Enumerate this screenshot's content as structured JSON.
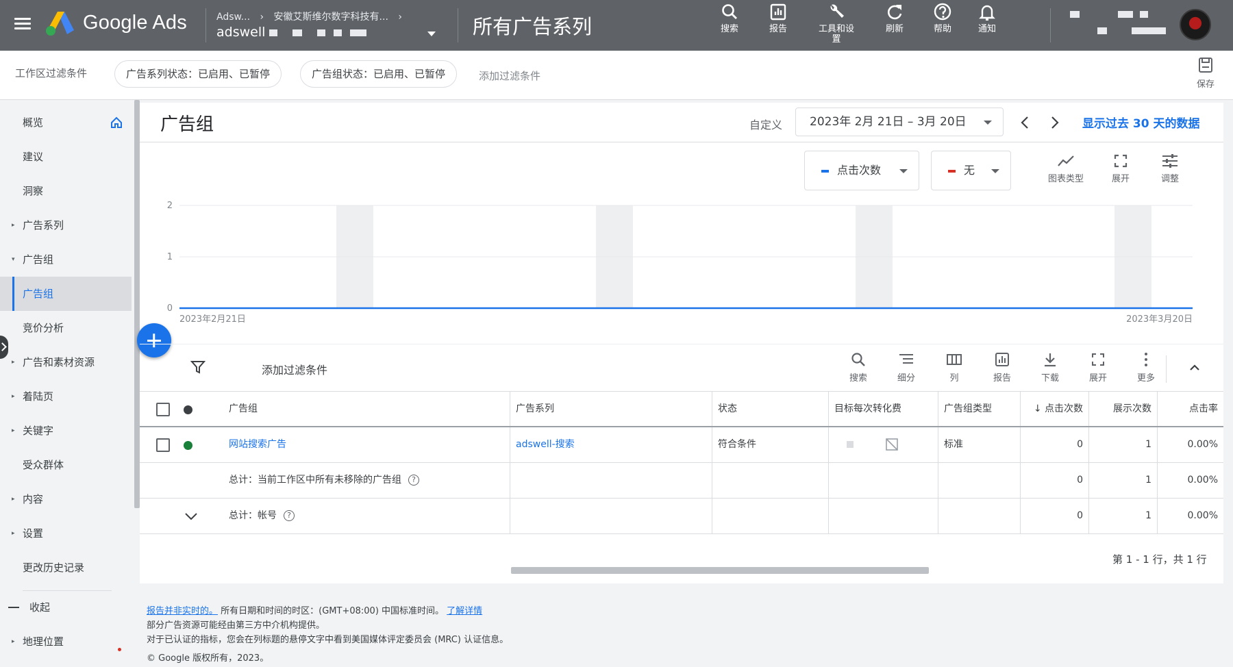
{
  "topbar": {
    "brand": "Google Ads",
    "breadcrumb_account": "Adsw...",
    "breadcrumb_company": "安徽艾斯维尔数字科技有...",
    "account_name": "adswell",
    "page_title": "所有广告系列",
    "tools": [
      {
        "label": "搜索",
        "icon": "search-icon"
      },
      {
        "label": "报告",
        "icon": "report-icon"
      },
      {
        "label": "工具和设置",
        "icon": "wrench-icon"
      },
      {
        "label": "刷新",
        "icon": "refresh-icon"
      },
      {
        "label": "帮助",
        "icon": "help-icon"
      },
      {
        "label": "通知",
        "icon": "bell-icon"
      }
    ]
  },
  "filterbar": {
    "label": "工作区过滤条件",
    "chip_campaign": "广告系列状态：已启用、已暂停",
    "chip_adgroup": "广告组状态：已启用、已暂停",
    "add_filter": "添加过滤条件",
    "save": "保存"
  },
  "sidebar": {
    "items": [
      {
        "label": "概览",
        "arrow": ""
      },
      {
        "label": "建议",
        "arrow": ""
      },
      {
        "label": "洞察",
        "arrow": ""
      },
      {
        "label": "广告系列",
        "arrow": "▸"
      },
      {
        "label": "广告组",
        "arrow": "▾"
      },
      {
        "label": "广告组",
        "arrow": ""
      },
      {
        "label": "竞价分析",
        "arrow": ""
      },
      {
        "label": "广告和素材资源",
        "arrow": "▸"
      },
      {
        "label": "着陆页",
        "arrow": "▸"
      },
      {
        "label": "关键字",
        "arrow": "▸"
      },
      {
        "label": "受众群体",
        "arrow": ""
      },
      {
        "label": "内容",
        "arrow": "▸"
      },
      {
        "label": "设置",
        "arrow": "▸"
      },
      {
        "label": "更改历史记录",
        "arrow": ""
      }
    ],
    "collapse_label": "收起",
    "geo_label": "地理位置"
  },
  "main": {
    "title": "广告组",
    "custom_label": "自定义",
    "date_range": "2023年 2月 21日 – 3月 20日",
    "show_30_days": "显示过去 30 天的数据",
    "metric1": "点击次数",
    "metric2": "无",
    "chart_tools": [
      "图表类型",
      "展开",
      "调整"
    ]
  },
  "chart_data": {
    "type": "line",
    "series": [
      {
        "name": "点击次数",
        "values": [
          0,
          0
        ]
      }
    ],
    "x": [
      "2023年2月21日",
      "2023年3月20日"
    ],
    "x_start_label": "2023年2月21日",
    "x_end_label": "2023年3月20日",
    "y_ticks": [
      "2",
      "1",
      "0"
    ],
    "ylim": [
      0,
      2
    ],
    "grid": true,
    "color": "#1a73e8"
  },
  "table_toolbar": {
    "add_filter": "添加过滤条件",
    "tools": [
      "搜索",
      "细分",
      "列",
      "报告",
      "下载",
      "展开",
      "更多"
    ]
  },
  "table": {
    "headers": [
      "广告组",
      "广告系列",
      "状态",
      "目标每次转化费",
      "广告组类型",
      "点击次数",
      "展示次数",
      "点击率"
    ],
    "rows": [
      {
        "adgroup": "网站搜索广告",
        "campaign": "adswell-搜索",
        "status": "符合条件",
        "type": "标准",
        "clicks": "0",
        "impressions": "1",
        "ctr": "0.00%"
      }
    ],
    "total_workspace": {
      "label": "总计：当前工作区中所有未移除的广告组",
      "clicks": "0",
      "impressions": "1",
      "ctr": "0.00%"
    },
    "total_account": {
      "label": "总计：帐号",
      "clicks": "0",
      "impressions": "1",
      "ctr": "0.00%"
    },
    "pager": "第 1 - 1 行，共 1 行"
  },
  "footer": {
    "not_realtime": "报告并非实时的。",
    "timezone": "所有日期和时间的时区：(GMT+08:00) 中国标准时间。",
    "learn_more": "了解详情",
    "line2": "部分广告资源可能经由第三方中介机构提供。",
    "line3": "对于已认证的指标，您会在列标题的悬停文字中看到美国媒体评定委员会 (MRC) 认证信息。",
    "copyright": "© Google 版权所有，2023。"
  }
}
